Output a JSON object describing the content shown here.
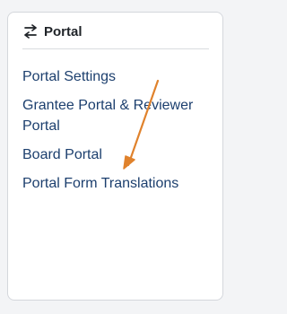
{
  "card": {
    "title": "Portal",
    "icon": "swap-arrows-icon"
  },
  "links": [
    {
      "label": "Portal Settings"
    },
    {
      "label": "Grantee Portal & Reviewer Portal"
    },
    {
      "label": "Board Portal"
    },
    {
      "label": "Portal Form Translations"
    }
  ],
  "colors": {
    "link": "#1c3f6e",
    "arrow": "#e0822c"
  }
}
